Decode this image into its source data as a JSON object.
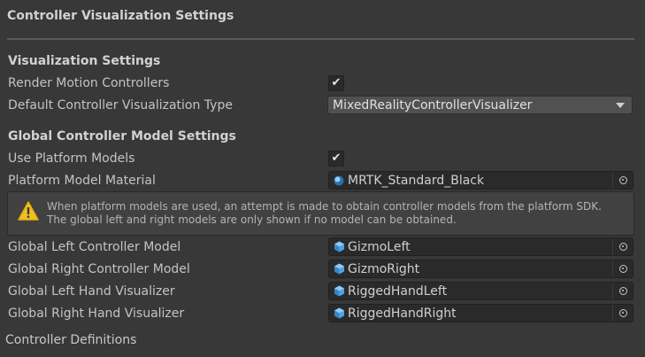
{
  "header": {
    "title": "Controller Visualization Settings"
  },
  "visualization": {
    "section_title": "Visualization Settings",
    "render_motion_controllers_label": "Render Motion Controllers",
    "render_motion_controllers_checked": true,
    "default_type_label": "Default Controller Visualization Type",
    "default_type_value": "MixedRealityControllerVisualizer"
  },
  "global_model": {
    "section_title": "Global Controller Model Settings",
    "use_platform_models_label": "Use Platform Models",
    "use_platform_models_checked": true,
    "platform_material_label": "Platform Model Material",
    "platform_material_value": "MRTK_Standard_Black",
    "help_line1": "When platform models are used, an attempt is made to obtain controller models from the platform SDK.",
    "help_line2": "The global left and right models are only shown if no model can be obtained.",
    "fields": [
      {
        "label": "Global Left Controller Model",
        "value": "GizmoLeft",
        "icon": "prefab-icon"
      },
      {
        "label": "Global Right Controller Model",
        "value": "GizmoRight",
        "icon": "prefab-icon"
      },
      {
        "label": "Global Left Hand Visualizer",
        "value": "RiggedHandLeft",
        "icon": "prefab-icon"
      },
      {
        "label": "Global Right Hand Visualizer",
        "value": "RiggedHandRight",
        "icon": "prefab-icon"
      }
    ]
  },
  "footer": {
    "label": "Controller Definitions"
  },
  "colors": {
    "background": "#383838",
    "field": "#2a2a2a",
    "prefab_icon": "#4fa3e0",
    "warning": "#f0c020"
  }
}
